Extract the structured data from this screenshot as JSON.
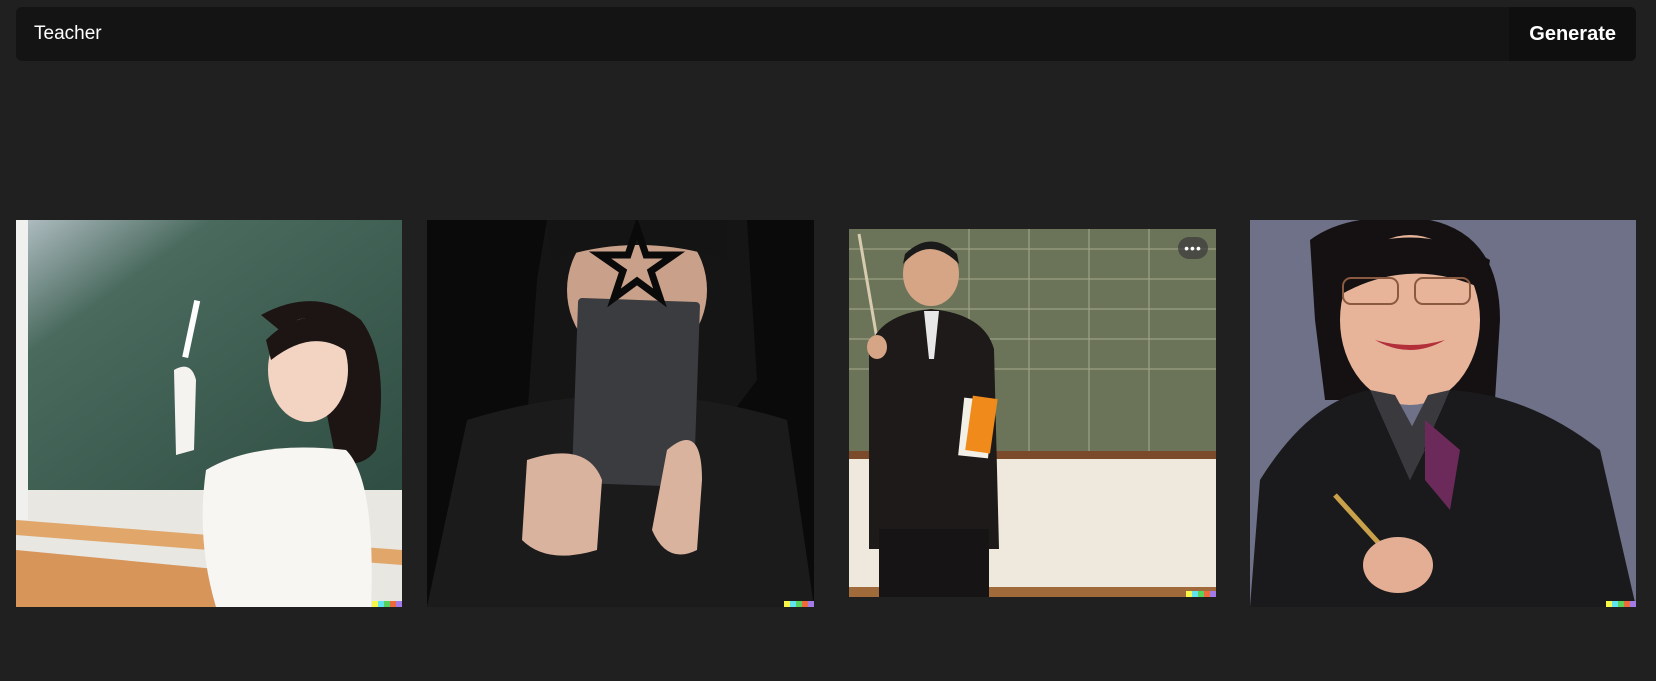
{
  "prompt": {
    "value": "Teacher",
    "placeholder": ""
  },
  "toolbar": {
    "generate_label": "Generate"
  },
  "results": [
    {
      "subject": "woman-at-chalkboard",
      "background": "#3f5e52"
    },
    {
      "subject": "person-holding-book-star-covering-face",
      "background": "#0a0a0a"
    },
    {
      "subject": "man-with-pointer-at-chalkboard",
      "background": "#6b7458",
      "more_label": "•••"
    },
    {
      "subject": "smiling-woman-with-pen",
      "background": "#6e7188"
    }
  ],
  "colors": {
    "page_bg": "#202020",
    "bar_bg": "#141414",
    "swatch": [
      "#f7f748",
      "#61e4f0",
      "#58d25a",
      "#ee6a3d",
      "#a27be8"
    ]
  }
}
